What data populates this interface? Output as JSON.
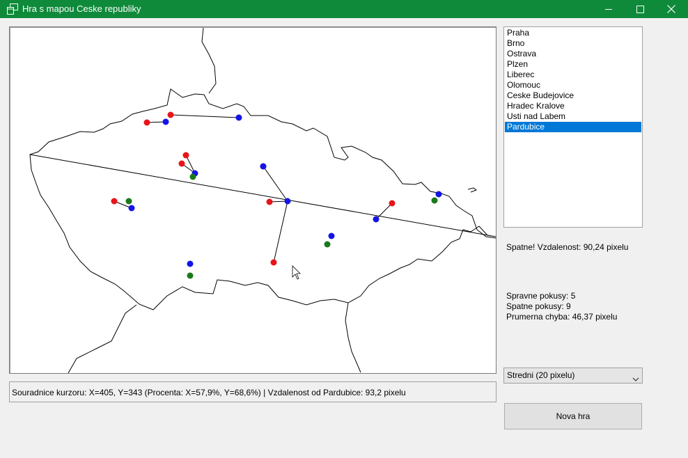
{
  "window": {
    "title": "Hra s mapou Ceske republiky",
    "icon": "app-window-icon",
    "controls": [
      "minimize-icon",
      "maximize-icon",
      "close-icon"
    ],
    "titlebar_color": "#0f8a3a"
  },
  "cities": {
    "items": [
      "Praha",
      "Brno",
      "Ostrava",
      "Plzen",
      "Liberec",
      "Olomouc",
      "Ceske Budejovice",
      "Hradec Kralove",
      "Usti nad Labem",
      "Pardubice"
    ],
    "selected": "Pardubice"
  },
  "result": {
    "message": "Spatne! Vzdalenost: 90,24 pixelu"
  },
  "stats": {
    "correct": "Spravne pokusy: 5",
    "wrong": "Spatne pokusy: 9",
    "avg_error": "Prumerna chyba: 46,37 pixelu"
  },
  "difficulty": {
    "selected": "Stredni (20 pixelu)"
  },
  "new_game_button": "Nova hra",
  "status": {
    "text": "Souradnice kurzoru: X=405, Y=343 (Procenta: X=57,9%, Y=68,6%) | Vzdalenost od Pardubice: 93,2 pixelu"
  },
  "map": {
    "colors": {
      "guess_wrong": "#e8141a",
      "true_location": "#1414e8",
      "guess_correct": "#1a7a1a",
      "line": "#000000",
      "border": "#000000"
    }
  }
}
